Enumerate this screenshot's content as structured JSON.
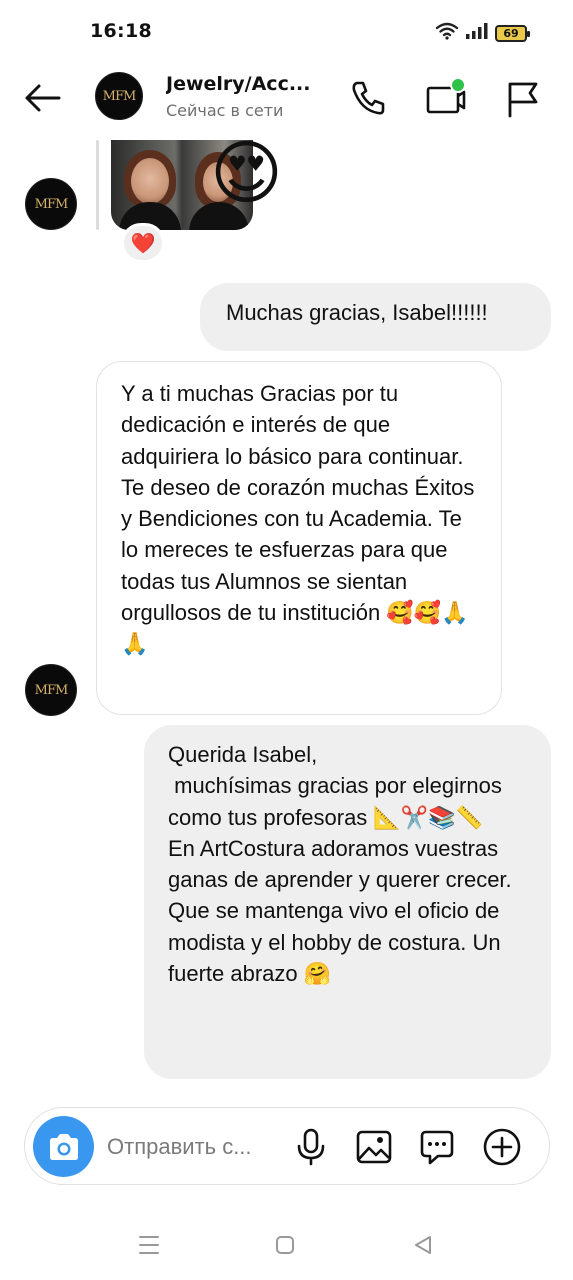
{
  "status_bar": {
    "time": "16:18",
    "battery": "69",
    "icons": [
      "wifi-icon",
      "signal-icon",
      "battery-icon"
    ]
  },
  "header": {
    "title": "Jewelry/Acc...",
    "subtitle": "Сейчас в сети",
    "avatar_text": "MFM",
    "icons": [
      "back-arrow-icon",
      "phone-icon",
      "video-call-icon",
      "flag-icon"
    ],
    "online_color": "#2fc24a"
  },
  "messages": [
    {
      "type": "photo",
      "sender": "them",
      "sticker": "😍",
      "reaction": "❤️"
    },
    {
      "type": "text",
      "sender": "me",
      "text": "Muchas gracias, Isabel!!!!!!"
    },
    {
      "type": "text",
      "sender": "them",
      "text": "Y a ti muchas Gracias por tu dedicación e interés de que adquiriera lo básico para continuar. Te deseo de corazón muchas Éxitos y Bendiciones con tu Academia. Te lo mereces te esfuerzas para que todas tus Alumnos se sientan orgullosos de tu institución 🥰🥰🙏🙏"
    },
    {
      "type": "text",
      "sender": "me",
      "text": "Querida Isabel,\n muchísimas gracias por elegirnos como tus profesoras 📐✂️📚📏\nEn ArtCostura adoramos vuestras ganas de aprender y querer crecer. Que se mantenga vivo el oficio de modista y el hobby de costura. Un fuerte abrazo 🤗"
    }
  ],
  "composer": {
    "placeholder": "Отправить с...",
    "icons": [
      "camera-icon",
      "microphone-icon",
      "gallery-icon",
      "sticker-icon",
      "add-icon"
    ],
    "camera_color": "#3a97f0"
  },
  "nav": {
    "icons": [
      "recent-apps-icon",
      "home-icon",
      "back-icon"
    ]
  },
  "colors": {
    "outgoing_bubble": "#efefef",
    "incoming_border": "#e3e3e3",
    "avatar_gold": "#d4b06a"
  }
}
